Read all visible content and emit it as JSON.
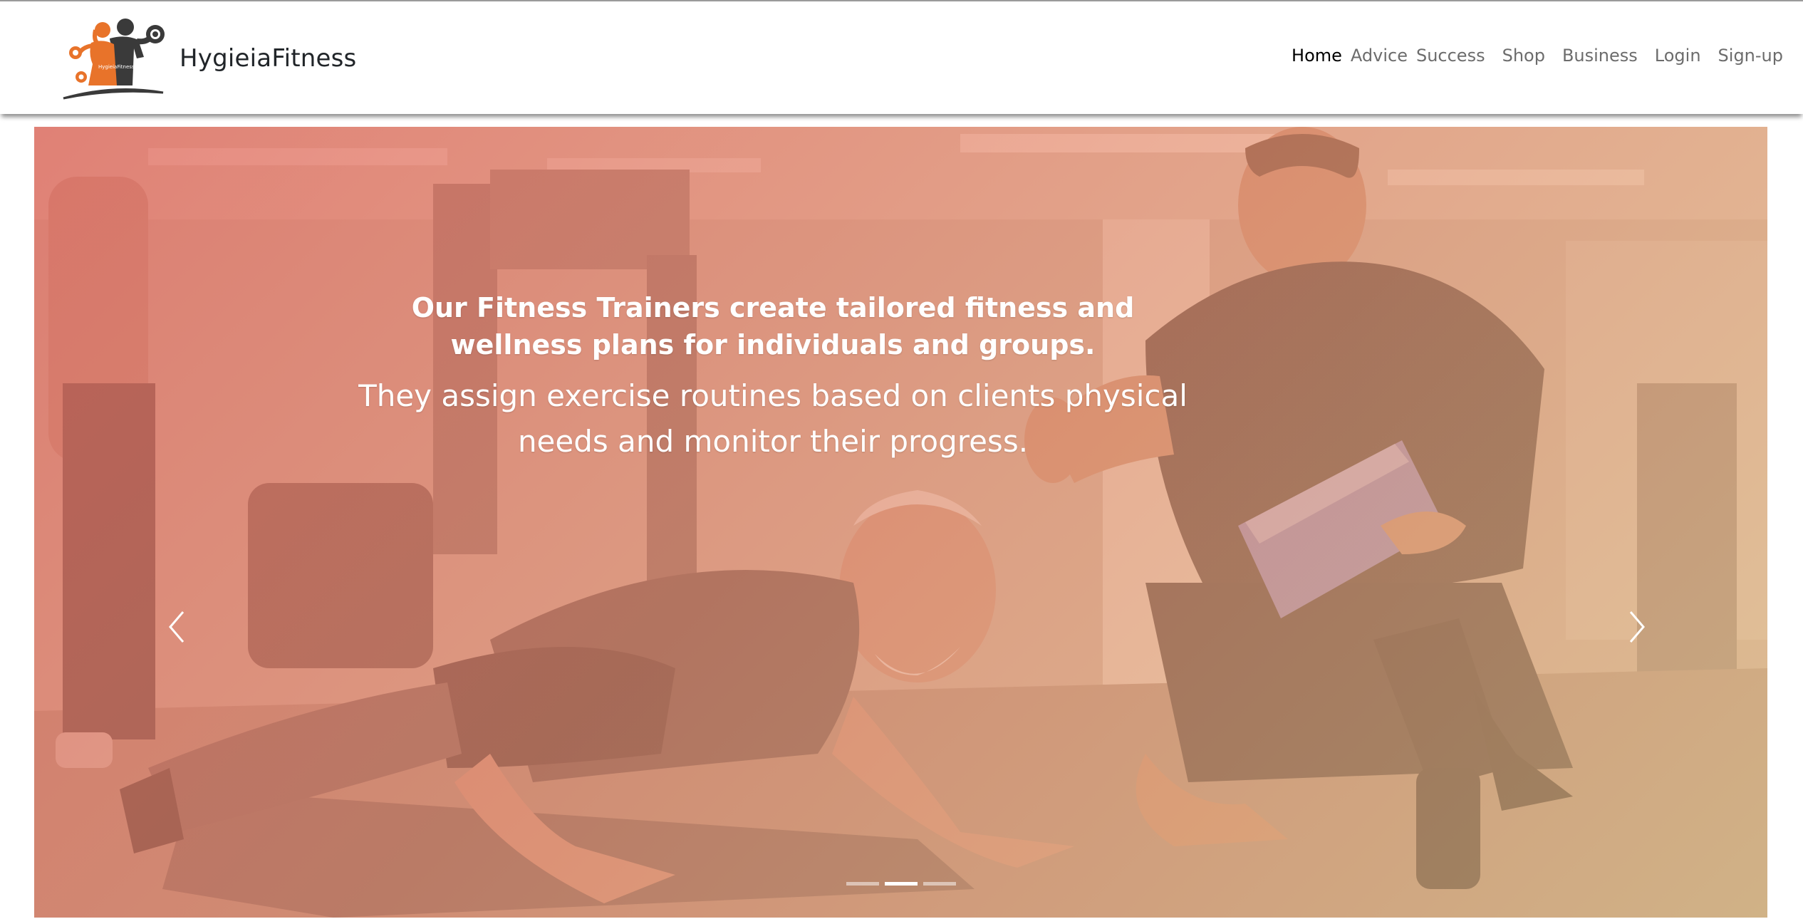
{
  "brand": {
    "name": "HygieiaFitness",
    "logo_text": "HygieiaFitness",
    "logo_icon": "fitness-couple-dumbbell-logo",
    "colors": {
      "orange": "#e8732a",
      "dark": "#3a3a3a"
    }
  },
  "nav": {
    "items": [
      {
        "label": "Home",
        "active": true
      },
      {
        "label": "Advice",
        "active": false
      },
      {
        "label": "Success",
        "active": false
      },
      {
        "label": "Shop",
        "active": false
      },
      {
        "label": "Business",
        "active": false
      },
      {
        "label": "Login",
        "active": false
      },
      {
        "label": "Sign-up",
        "active": false
      }
    ]
  },
  "carousel": {
    "slide": {
      "heading": "Our Fitness Trainers create tailored fitness and wellness plans for individuals and groups.",
      "text": "They assign exercise routines based on clients physical needs and monitor their progress.",
      "image_icon": "trainer-with-client-pushup-photo"
    },
    "prev_icon": "chevron-left-icon",
    "next_icon": "chevron-right-icon",
    "indicators": [
      {
        "active": false
      },
      {
        "active": true
      },
      {
        "active": false
      }
    ],
    "overlay_colors": [
      "#e26e64",
      "#e8c88c"
    ]
  }
}
